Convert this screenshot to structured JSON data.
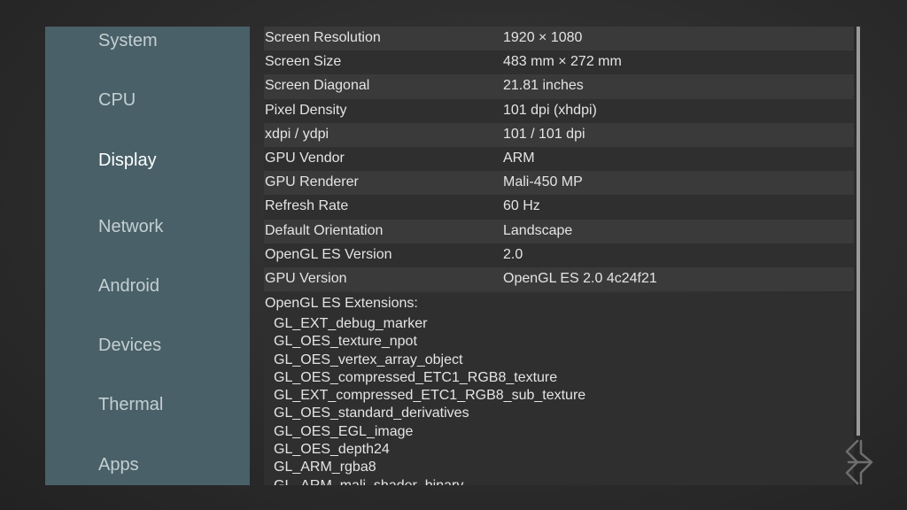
{
  "sidebar": {
    "items": [
      {
        "label": "System"
      },
      {
        "label": "CPU"
      },
      {
        "label": "Display"
      },
      {
        "label": "Network"
      },
      {
        "label": "Android"
      },
      {
        "label": "Devices"
      },
      {
        "label": "Thermal"
      },
      {
        "label": "Apps"
      }
    ],
    "active": "Display"
  },
  "display_info": {
    "rows": [
      {
        "label": "Screen Resolution",
        "value": "1920 × 1080"
      },
      {
        "label": "Screen Size",
        "value": "483 mm × 272 mm"
      },
      {
        "label": "Screen Diagonal",
        "value": "21.81 inches"
      },
      {
        "label": "Pixel Density",
        "value": "101 dpi (xhdpi)"
      },
      {
        "label": "xdpi / ydpi",
        "value": "101 / 101 dpi"
      },
      {
        "label": "GPU Vendor",
        "value": "ARM"
      },
      {
        "label": "GPU Renderer",
        "value": "Mali-450 MP"
      },
      {
        "label": "Refresh Rate",
        "value": "60 Hz"
      },
      {
        "label": "Default Orientation",
        "value": "Landscape"
      },
      {
        "label": "OpenGL ES Version",
        "value": "2.0"
      },
      {
        "label": "GPU Version",
        "value": "OpenGL ES 2.0 4c24f21"
      }
    ],
    "extensions_title": "OpenGL ES Extensions:",
    "extensions": [
      "GL_EXT_debug_marker",
      "GL_OES_texture_npot",
      "GL_OES_vertex_array_object",
      "GL_OES_compressed_ETC1_RGB8_texture",
      "GL_EXT_compressed_ETC1_RGB8_sub_texture",
      "GL_OES_standard_derivatives",
      "GL_OES_EGL_image",
      "GL_OES_depth24",
      "GL_ARM_rgba8",
      "GL_ARM_mali_shader_binary"
    ]
  },
  "colors": {
    "sidebar_bg": "#496068",
    "row_light": "#3a3a3a",
    "row_dark": "#2f2f2f",
    "text": "#e4e4e4"
  },
  "icons": {
    "watermark": "logo-watermark-icon"
  }
}
